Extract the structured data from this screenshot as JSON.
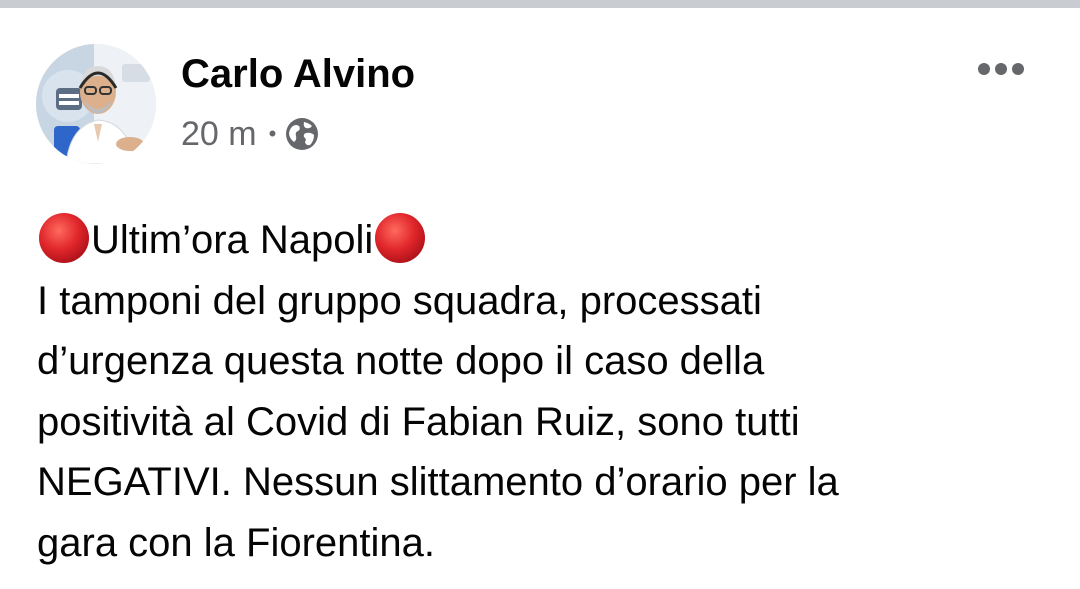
{
  "post": {
    "author": {
      "name": "Carlo Alvino",
      "avatar": "profile-photo"
    },
    "meta": {
      "time": "20 m",
      "separator": "•",
      "audience_icon": "globe-icon"
    },
    "more_icon": "more-horizontal-icon",
    "body": {
      "headline": "Ultim’ora Napoli",
      "headline_icon": "red-circle-emoji",
      "lines": [
        "I tamponi del gruppo squadra, processati",
        "d’urgenza questa notte dopo il caso della",
        "positività al Covid di Fabian Ruiz, sono tutti",
        "NEGATIVI. Nessun slittamento d’orario per la",
        "gara con la Fiorentina."
      ]
    }
  },
  "colors": {
    "text": "#050505",
    "secondary_text": "#65676b",
    "top_strip": "#c9ccd1",
    "red_circle": "#e0262b"
  }
}
